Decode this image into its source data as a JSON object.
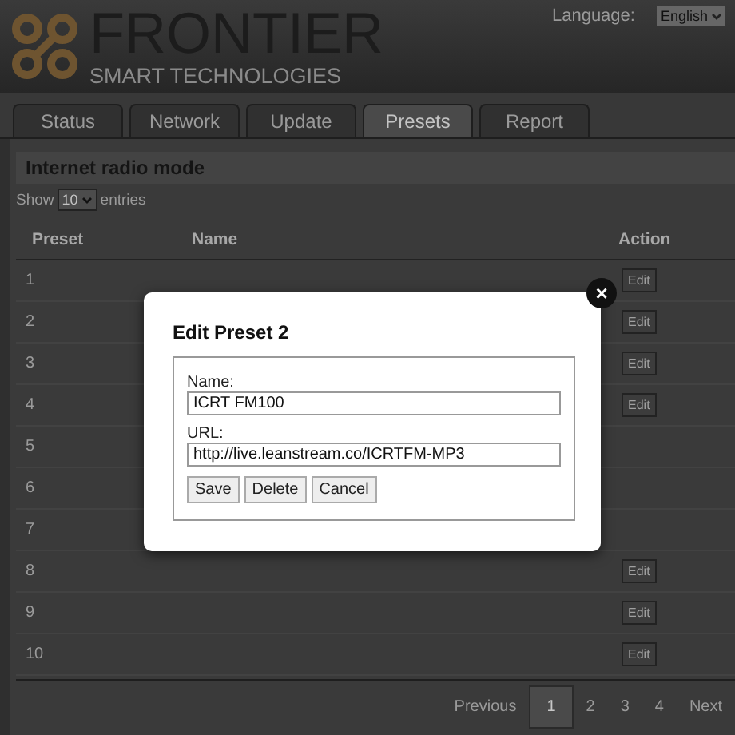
{
  "header": {
    "brand": "FRONTIER",
    "tagline": "SMART TECHNOLOGIES",
    "language_label": "Language:",
    "language_value": "English"
  },
  "tabs": [
    {
      "label": "Status",
      "selected": false
    },
    {
      "label": "Network",
      "selected": false
    },
    {
      "label": "Update",
      "selected": false
    },
    {
      "label": "Presets",
      "selected": true
    },
    {
      "label": "Report",
      "selected": false
    }
  ],
  "section_title": "Internet radio mode",
  "length_menu": {
    "before": "Show",
    "value": "10",
    "after": "entries"
  },
  "table": {
    "columns": [
      "Preset",
      "Name",
      "Action"
    ],
    "rows": [
      {
        "preset": "1",
        "action": "Edit"
      },
      {
        "preset": "2",
        "action": "Edit"
      },
      {
        "preset": "3",
        "action": "Edit"
      },
      {
        "preset": "4",
        "action": "Edit"
      },
      {
        "preset": "5"
      },
      {
        "preset": "6"
      },
      {
        "preset": "7"
      },
      {
        "preset": "8",
        "action": "Edit"
      },
      {
        "preset": "9",
        "action": "Edit"
      },
      {
        "preset": "10",
        "action": "Edit"
      }
    ]
  },
  "pagination": [
    {
      "label": "Previous",
      "selected": false
    },
    {
      "label": "1",
      "selected": true
    },
    {
      "label": "2",
      "selected": false
    },
    {
      "label": "3",
      "selected": false
    },
    {
      "label": "4",
      "selected": false
    },
    {
      "label": "Next",
      "selected": false
    }
  ],
  "dialog": {
    "title": "Edit Preset 2",
    "close": "×",
    "fields": [
      {
        "label": "Name:",
        "value": "ICRT FM100"
      },
      {
        "label": "URL:",
        "value": "http://live.leanstream.co/ICRTFM-MP3"
      }
    ],
    "buttons": [
      "Save",
      "Delete",
      "Cancel"
    ]
  }
}
